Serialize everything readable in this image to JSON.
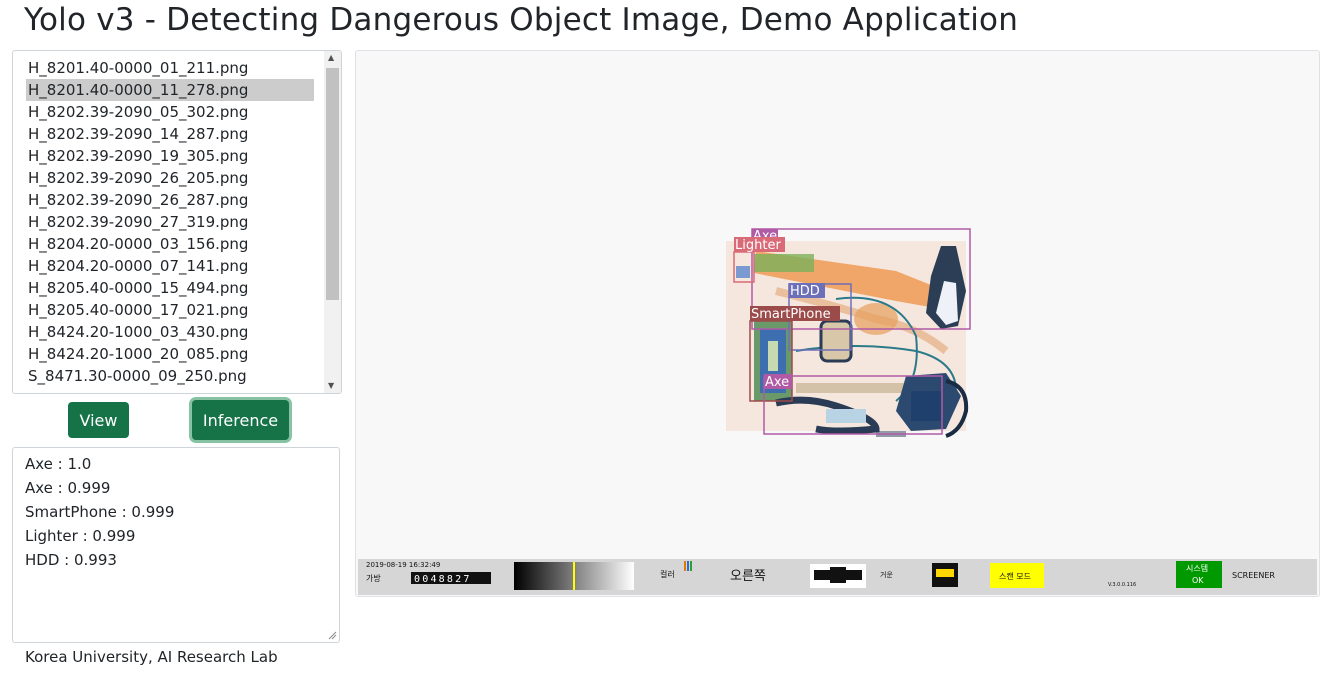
{
  "app": {
    "title": "Yolo v3 - Detecting Dangerous Object Image, Demo Application"
  },
  "file_list": {
    "items": [
      "H_8201.40-0000_01_211.png",
      "H_8201.40-0000_11_278.png",
      "H_8202.39-2090_05_302.png",
      "H_8202.39-2090_14_287.png",
      "H_8202.39-2090_19_305.png",
      "H_8202.39-2090_26_205.png",
      "H_8202.39-2090_26_287.png",
      "H_8202.39-2090_27_319.png",
      "H_8204.20-0000_03_156.png",
      "H_8204.20-0000_07_141.png",
      "H_8205.40-0000_15_494.png",
      "H_8205.40-0000_17_021.png",
      "H_8424.20-1000_03_430.png",
      "H_8424.20-1000_20_085.png",
      "S_8471.30-0000_09_250.png"
    ],
    "selected_index": 1
  },
  "buttons": {
    "view_label": "View",
    "inference_label": "Inference",
    "color": "#157347"
  },
  "results": [
    "Axe : 1.0",
    "Axe : 0.999",
    "SmartPhone : 0.999",
    "Lighter : 0.999",
    "HDD : 0.993"
  ],
  "detections": {
    "axe_1": "Axe",
    "lighter": "Lighter",
    "hdd": "HDD",
    "smartphone": "SmartPhone",
    "axe_2": "Axe"
  },
  "scanner_status": {
    "timestamp": "2019-08-19 16:32:49",
    "bag_label": "가방",
    "bag_count": "0048827",
    "color_label": "컬러",
    "direction": "오른쪽",
    "weight_label": "거운",
    "scan_mode": "스캔 모드",
    "system_label": "시스템",
    "system_status": "OK",
    "version": "V.3.0.0.116",
    "role": "SCREENER"
  },
  "footer": {
    "text": "Korea University, AI Research Lab"
  },
  "colors": {
    "axe": "#b05aa6",
    "lighter": "#d96a77",
    "hdd": "#6d6fb8",
    "smartphone": "#9b4b49",
    "accent_green": "#157347",
    "scan_mode_bg": "#ffff00",
    "system_ok_bg": "#009900"
  }
}
